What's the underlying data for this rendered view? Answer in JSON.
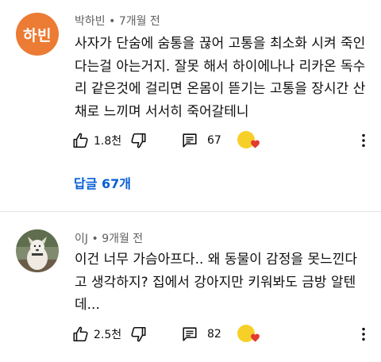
{
  "comments": [
    {
      "author": "박하빈",
      "time": "7개월 전",
      "avatar_initials": "하빈",
      "avatar_color": "#ec7b33",
      "lines": [
        "사자가   단숨에 숨통을 끊어 고통을 최소화 시켜 죽인",
        "다는걸 아는거지. 잘못 해서 하이에나나 리카온 독수",
        "리 같은것에 걸리면 온몸이 뜯기는 고통을 장시간 산",
        "채로 느끼며 서서히 죽어갈테니"
      ],
      "like_count": "1.8천",
      "reply_count": "67",
      "replies_link": "답글 67개",
      "creator_heart": true
    },
    {
      "author": "이J",
      "time": "9개월 전",
      "lines": [
        "이건   너무 가슴아프다..  왜 동물이  감정을 못느낀다",
        "고 생각하지?  집에서 강아지만 키워봐도 금방 알텐",
        "데..."
      ],
      "like_count": "2.5천",
      "reply_count": "82",
      "creator_heart": true
    }
  ],
  "separator": "•",
  "colors": {
    "link": "#065fd4",
    "meta": "#606060",
    "heart": "#e33b2e",
    "creator_badge": "#f6d028"
  },
  "icons": [
    "thumbs-up-icon",
    "thumbs-down-icon",
    "reply-comment-icon",
    "creator-heart-icon",
    "more-vert-icon"
  ]
}
